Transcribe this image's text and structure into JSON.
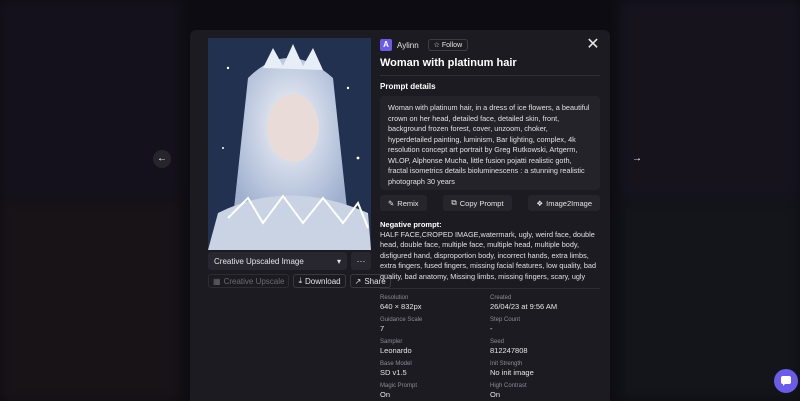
{
  "author": {
    "initial": "A",
    "name": "Aylinn",
    "follow_label": "Follow"
  },
  "title": "Woman with platinum hair",
  "prompt_details": {
    "label": "Prompt details",
    "text": "Woman with platinum hair, in a dress of ice flowers, a beautiful crown on her head, detailed face, detailed skin, front, background frozen forest, cover, unzoom, choker, hyperdetailed painting, luminism, Bar lighting, complex, 4k resolution concept art portrait by Greg Rutkowski, Artgerm, WLOP, Alphonse Mucha, little fusion pojatti realistic goth, fractal isometrics details bioluminescens : a stunning realistic photograph 30 years",
    "actions": {
      "remix": "Remix",
      "copy": "Copy Prompt",
      "image2image": "Image2Image"
    }
  },
  "negative_prompt": {
    "label": "Negative prompt:",
    "text": "HALF FACE,CROPED IMAGE,watermark, ugly, weird face, double head, double face, multiple face, multiple head, multiple body, disfigured hand, disproportion body, incorrect hands, extra limbs, extra fingers, fused fingers, missing facial features, low quality, bad quality, bad anatomy, Missing limbs, missing fingers, scary, ugly"
  },
  "image_controls": {
    "dropdown_value": "Creative Upscaled Image",
    "more_label": "···",
    "creative_upscale": "Creative Upscale",
    "download": "Download",
    "share": "Share"
  },
  "meta": {
    "resolution": {
      "label": "Resolution",
      "value": "640 × 832px"
    },
    "created": {
      "label": "Created",
      "value": "26/04/23 at 9:56 AM"
    },
    "guidance": {
      "label": "Guidance Scale",
      "value": "7"
    },
    "step_count": {
      "label": "Step Count",
      "value": "-"
    },
    "sampler": {
      "label": "Sampler",
      "value": "Leonardo"
    },
    "seed": {
      "label": "Seed",
      "value": "812247808"
    },
    "base_model": {
      "label": "Base Model",
      "value": "SD v1.5"
    },
    "init_strength": {
      "label": "Init Strength",
      "value": "No init image"
    },
    "magic_prompt": {
      "label": "Magic Prompt",
      "value": "On"
    },
    "high_contrast": {
      "label": "High Contrast",
      "value": "On"
    }
  },
  "colors": {
    "accent": "#6b5ce7",
    "modal_bg": "#1c1b22",
    "panel_bg": "#242329"
  },
  "icons": [
    "close-icon",
    "arrow-left-icon",
    "arrow-right-icon",
    "star-icon",
    "chevron-down-icon",
    "chat-icon"
  ]
}
